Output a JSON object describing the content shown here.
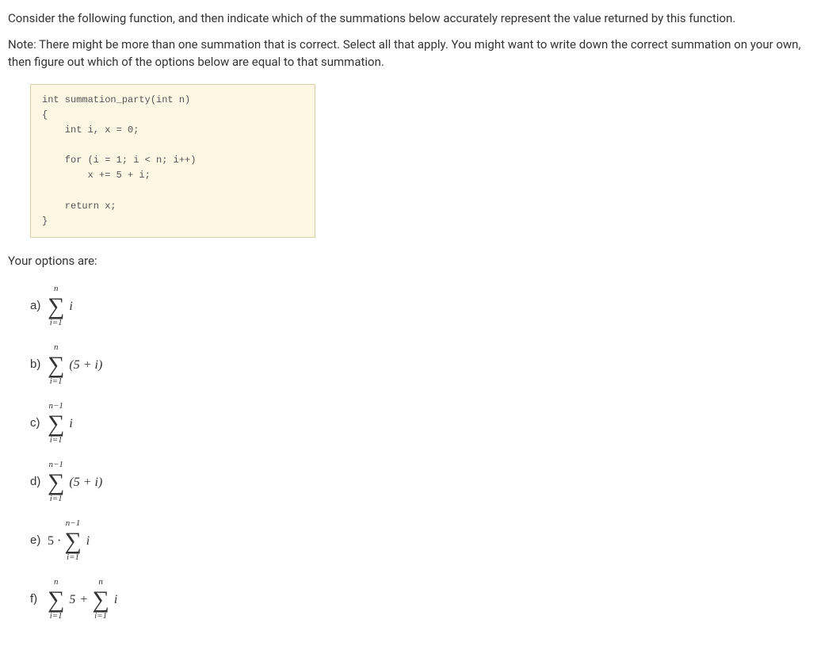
{
  "intro": "Consider the following function, and then indicate which of the summations below accurately represent the value returned by this function.",
  "note": "Note: There might be more than one summation that is correct. Select all that apply. You might want to write down the correct summation on your own, then figure out which of the options below are equal to that summation.",
  "code": "int summation_party(int n)\n{\n    int i, x = 0;\n\n    for (i = 1; i < n; i++)\n        x += 5 + i;\n\n    return x;\n}",
  "options_header": "Your options are:",
  "opts": {
    "a": {
      "letter": "a)",
      "upper": "n",
      "lower": "i=1",
      "body": "i"
    },
    "b": {
      "letter": "b)",
      "upper": "n",
      "lower": "i=1",
      "body": "(5 + i)"
    },
    "c": {
      "letter": "c)",
      "upper": "n−1",
      "lower": "i=1",
      "body": "i"
    },
    "d": {
      "letter": "d)",
      "upper": "n−1",
      "lower": "i=1",
      "body": "(5 + i)"
    },
    "e": {
      "letter": "e)",
      "prefix": "5 · ",
      "upper": "n−1",
      "lower": "i=1",
      "body": "i"
    },
    "f": {
      "letter": "f)",
      "upper1": "n",
      "lower1": "i=1",
      "body1": "5",
      "upper2": "n",
      "lower2": "i=1",
      "body2": "i"
    }
  },
  "sigma": "∑",
  "plus": "+"
}
